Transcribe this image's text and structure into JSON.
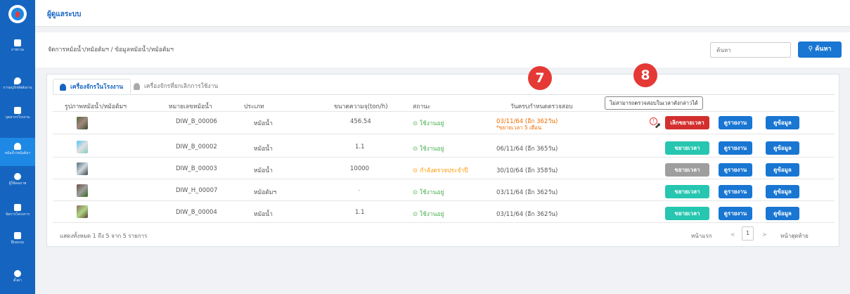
{
  "sidebar": {
    "items": [
      {
        "icon": "computer-icon",
        "label": "ภาพรวม"
      },
      {
        "icon": "location-pin-icon",
        "label": "การอนุรักษ์พลังงาน"
      },
      {
        "icon": "factory-icon",
        "label": "บุคลากรโรงงาน"
      },
      {
        "icon": "boiler-icon",
        "label": "หม้อน้ำ/หม้อต้มฯ"
      },
      {
        "icon": "users-icon",
        "label": "ผู้ใช้คลภาพ"
      },
      {
        "icon": "clipboard-icon",
        "label": "จัดการโครงการ"
      },
      {
        "icon": "training-icon",
        "label": "ฝึกอบรม"
      },
      {
        "icon": "gear-icon",
        "label": "ตั้งค่า"
      }
    ]
  },
  "header": {
    "title": "ผู้ดูแลระบบ"
  },
  "breadcrumb": "จัดการหม้อน้ำ/หม้อต้มฯ / ข้อมูลหม้อน้ำ/หม้อต้มฯ",
  "search": {
    "placeholder": "ค้นหา",
    "button_label": "ค้นหา"
  },
  "tabs": {
    "active": "เครื่องจักรในโรงงาน",
    "inactive": "เครื่องจักรที่ยกเลิกการใช้งาน"
  },
  "table": {
    "headers": [
      "รูปภาพหม้อน้ำ/หม้อต้มฯ",
      "หมายเลขหม้อน้ำ",
      "ประเภท",
      "ขนาดความจุ(ton/h)",
      "สถานะ",
      "วันครบกำหนดตรวจสอบ"
    ],
    "rows": [
      {
        "number": "DIW_B_00006",
        "type": "หม้อน้ำ",
        "capacity": "456.54",
        "status": "ใช้งานอยู่",
        "due": "03/11/64 (อีก 362วัน)",
        "due_note": "*ขยายเวลา 5 เดือน",
        "action": "เลิกขยายเวลา"
      },
      {
        "number": "DIW_B_00002",
        "type": "หม้อน้ำ",
        "capacity": "1.1",
        "status": "ใช้งานอยู่",
        "due": "06/11/64 (อีก 365วัน)",
        "due_note": "",
        "action": "ขยายเวลา"
      },
      {
        "number": "DIW_B_00003",
        "type": "หม้อน้ำ",
        "capacity": "10000",
        "status": "กำลังตรวจประจำปี",
        "due": "30/10/64 (อีก 358วัน)",
        "due_note": "",
        "action": "ขยายเวลา"
      },
      {
        "number": "DIW_H_00007",
        "type": "หม้อต้มฯ",
        "capacity": "-",
        "status": "ใช้งานอยู่",
        "due": "03/11/64 (อีก 362วัน)",
        "due_note": "",
        "action": "ขยายเวลา"
      },
      {
        "number": "DIW_B_00004",
        "type": "หม้อน้ำ",
        "capacity": "1.1",
        "status": "ใช้งานอยู่",
        "due": "03/11/64 (อีก 362วัน)",
        "due_note": "",
        "action": "ขยายเวลา"
      }
    ],
    "view_work_label": "ดูรายงาน",
    "view_info_label": "ดูข้อมูล"
  },
  "tooltip": "ไม่สามารถตรวจสอบในเวลาดังกล่าวได้",
  "annotations": [
    "7",
    "8"
  ],
  "footer": {
    "info": "แสดงทั้งหมด 1 ถึง 5 จาก 5 รายการ",
    "first": "หน้าแรก",
    "prev": "<",
    "page": "1",
    "next": ">",
    "last": "หน้าสุดท้าย"
  }
}
